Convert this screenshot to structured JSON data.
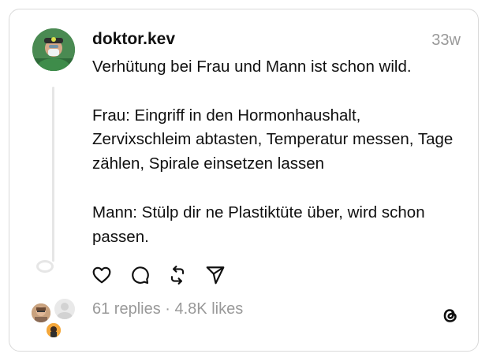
{
  "post": {
    "username": "doktor.kev",
    "timestamp": "33w",
    "text": "Verhütung bei Frau und Mann ist schon wild.\n\nFrau: Eingriff in den Hormonhaushalt, Zervixschleim abtasten, Temperatur messen, Tage zählen, Spirale einsetzen lassen\n\nMann: Stülp dir ne Plastiktüte über, wird schon passen."
  },
  "stats": {
    "summary": "61 replies · 4.8K likes"
  },
  "icons": {
    "like": "heart-icon",
    "reply": "comment-icon",
    "repost": "repost-icon",
    "share": "send-icon",
    "app": "threads-logo-icon"
  },
  "colors": {
    "text": "#101010",
    "secondary": "#999999",
    "border": "#d9d9d9",
    "thread_line": "#e6e6e6"
  }
}
